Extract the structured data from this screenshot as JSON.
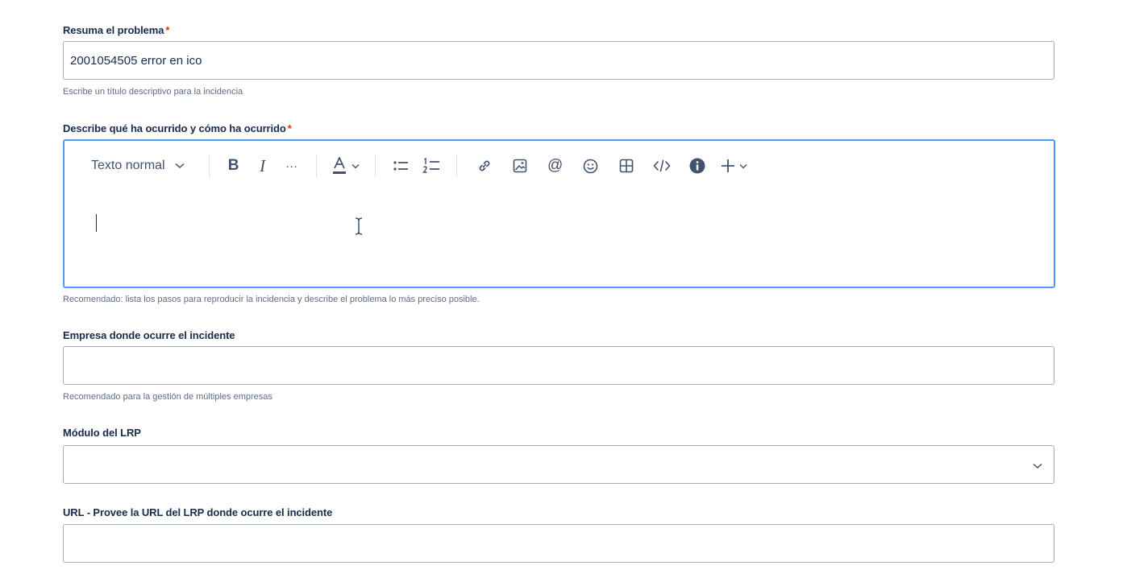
{
  "summary": {
    "label": "Resuma el problema",
    "required_mark": "*",
    "value": "2001054505 error en ico",
    "helper": "Escribe un título descriptivo para la incidencia"
  },
  "description": {
    "label": "Describe qué ha ocurrido y cómo ha ocurrido",
    "required_mark": "*",
    "text_style": "Texto normal",
    "more_label": "···",
    "helper": "Recomendado: lista los pasos para reproducir la incidencia y describe el problema lo más preciso posible."
  },
  "company": {
    "label": "Empresa donde ocurre el incidente",
    "value": "",
    "helper": "Recomendado para la gestión de múltiples empresas"
  },
  "module": {
    "label": "Módulo del LRP",
    "value": ""
  },
  "url": {
    "label": "URL - Provee la URL del LRP donde ocurre el incidente",
    "value": ""
  },
  "colors": {
    "focus_border": "#4c9aff",
    "required": "#de350b",
    "text": "#172b4d",
    "icon": "#42526e"
  },
  "icons": [
    "chevron-down-icon",
    "bold-icon",
    "italic-icon",
    "more-icon",
    "text-color-icon",
    "bullet-list-icon",
    "numbered-list-icon",
    "link-icon",
    "image-icon",
    "mention-icon",
    "emoji-icon",
    "table-icon",
    "code-icon",
    "info-icon",
    "plus-icon"
  ]
}
